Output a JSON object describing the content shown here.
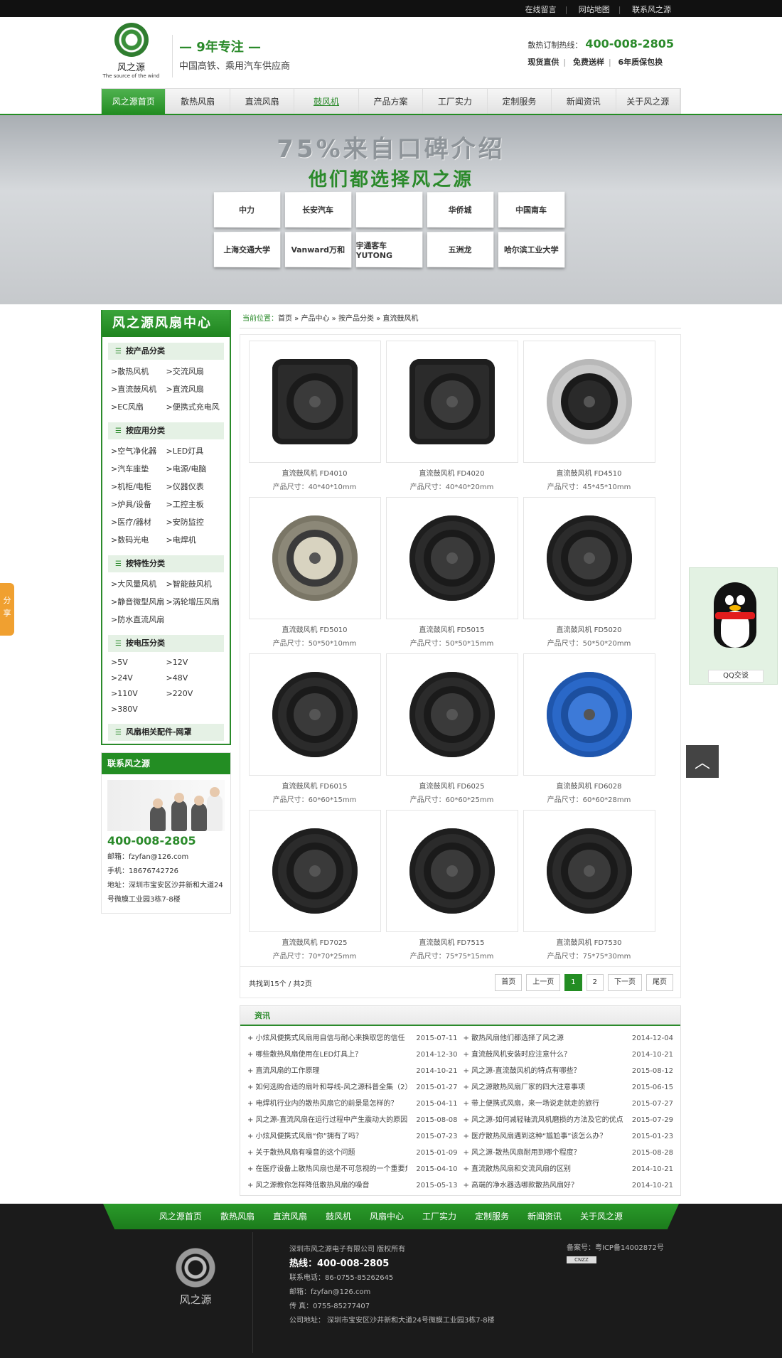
{
  "topbar": {
    "links": [
      "在线留言",
      "网站地图",
      "联系风之源"
    ]
  },
  "header": {
    "logo_cn": "风之源",
    "logo_en": "The source of the wind",
    "slogan_main": "— 9年专注 —",
    "slogan_sub": "中国高铁、乘用汽车供应商",
    "hotline_label": "散热订制热线：",
    "hotline": "400-008-2805",
    "features": [
      "现货直供",
      "免费送样",
      "6年质保包换"
    ]
  },
  "nav": [
    "风之源首页",
    "散热风扇",
    "直流风扇",
    "鼓风机",
    "产品方案",
    "工厂实力",
    "定制服务",
    "新闻资讯",
    "关于风之源"
  ],
  "banner": {
    "title": "75%来自口碑介绍",
    "subtitle": "他们都选择风之源",
    "logos": [
      "中力",
      "长安汽车",
      "",
      "华侨城",
      "中国南车",
      "上海交通大学",
      "Vanward万和",
      "宇通客车 YUTONG",
      "五洲龙",
      "哈尔滨工业大学"
    ]
  },
  "sidebar": {
    "title": "风之源风扇中心",
    "categories": [
      {
        "title": "按产品分类",
        "items": [
          ">散热风机",
          ">交流风扇",
          ">直流鼓风机",
          ">直流风扇",
          ">EC风扇",
          ">便携式充电风"
        ]
      },
      {
        "title": "按应用分类",
        "items": [
          ">空气净化器",
          ">LED灯具",
          ">汽车座垫",
          ">电源/电脑",
          ">机柜/电柜",
          ">仪器仪表",
          ">炉具/设备",
          ">工控主板",
          ">医疗/器材",
          ">安防监控",
          ">数码光电",
          ">电焊机"
        ]
      },
      {
        "title": "按特性分类",
        "items": [
          ">大风量风机",
          ">智能鼓风机",
          ">静音微型风扇",
          ">涡轮增压风扇",
          ">防水直流风扇"
        ]
      },
      {
        "title": "按电压分类",
        "items": [
          ">5V",
          ">12V",
          ">24V",
          ">48V",
          ">110V",
          ">220V",
          ">380V"
        ]
      },
      {
        "title": "风扇相关配件-网罩",
        "items": []
      }
    ],
    "contact": {
      "title": "联系风之源",
      "phone": "400-008-2805",
      "email": "邮箱：fzyfan@126.com",
      "mobile": "手机：18676742726",
      "address": "地址：深圳市宝安区沙井新和大道24号微膜工业园3栋7-8楼"
    }
  },
  "breadcrumb": {
    "label": "当前位置：",
    "path": "首页 » 产品中心 » 按产品分类 » 直流鼓风机"
  },
  "products": [
    {
      "name": "直流鼓风机 FD4010",
      "size": "产品尺寸：40*40*10mm",
      "style": "sq"
    },
    {
      "name": "直流鼓风机 FD4020",
      "size": "产品尺寸：40*40*20mm",
      "style": "sq"
    },
    {
      "name": "直流鼓风机 FD4510",
      "size": "产品尺寸：45*45*10mm",
      "style": "gray"
    },
    {
      "name": "直流鼓风机 FD5010",
      "size": "产品尺寸：50*50*10mm",
      "style": "bronze"
    },
    {
      "name": "直流鼓风机 FD5015",
      "size": "产品尺寸：50*50*15mm",
      "style": ""
    },
    {
      "name": "直流鼓风机 FD5020",
      "size": "产品尺寸：50*50*20mm",
      "style": ""
    },
    {
      "name": "直流鼓风机 FD6015",
      "size": "产品尺寸：60*60*15mm",
      "style": ""
    },
    {
      "name": "直流鼓风机 FD6025",
      "size": "产品尺寸：60*60*25mm",
      "style": ""
    },
    {
      "name": "直流鼓风机 FD6028",
      "size": "产品尺寸：60*60*28mm",
      "style": "blue"
    },
    {
      "name": "直流鼓风机 FD7025",
      "size": "产品尺寸：70*70*25mm",
      "style": ""
    },
    {
      "name": "直流鼓风机 FD7515",
      "size": "产品尺寸：75*75*15mm",
      "style": ""
    },
    {
      "name": "直流鼓风机 FD7530",
      "size": "产品尺寸：75*75*30mm",
      "style": ""
    }
  ],
  "pager": {
    "total": "共找到15个 / 共2页",
    "buttons": [
      "首页",
      "上一页",
      "1",
      "2",
      "下一页",
      "尾页"
    ],
    "current": "1"
  },
  "news": {
    "title": "资讯",
    "left": [
      {
        "t": "+ 小炫风便携式风扇用自信与耐心来换取您的信任",
        "d": "2015-07-11"
      },
      {
        "t": "+ 哪些散热风扇使用在LED灯具上？",
        "d": "2014-12-30"
      },
      {
        "t": "+ 直流风扇的工作原理",
        "d": "2014-10-21"
      },
      {
        "t": "+ 如何选购合适的扇叶和导线-风之源科普全集（2）",
        "d": "2015-01-27"
      },
      {
        "t": "+ 电焊机行业内的散热风扇它的前景是怎样的？",
        "d": "2015-04-11"
      },
      {
        "t": "+ 风之源-直流风扇在运行过程中产生震动大的原因是",
        "d": "2015-08-08"
      },
      {
        "t": "+ 小炫风便携式风扇“你”拥有了吗？",
        "d": "2015-07-23"
      },
      {
        "t": "+ 关于散热风扇有噪音的这个问题",
        "d": "2015-01-09"
      },
      {
        "t": "+ 在医疗设备上散热风扇也是不可忽视的一个重要角",
        "d": "2015-04-10"
      },
      {
        "t": "+ 风之源教你怎样降低散热风扇的噪音",
        "d": "2015-05-13"
      }
    ],
    "right": [
      {
        "t": "+ 散热风扇他们都选择了风之源",
        "d": "2014-12-04"
      },
      {
        "t": "+ 直流鼓风机安装时应注意什么？",
        "d": "2014-10-21"
      },
      {
        "t": "+ 风之源-直流鼓风机的特点有哪些？",
        "d": "2015-08-12"
      },
      {
        "t": "+ 风之源散热风扇厂家的四大注意事项",
        "d": "2015-06-15"
      },
      {
        "t": "+ 带上便携式风扇，来一场说走就走的旅行",
        "d": "2015-07-27"
      },
      {
        "t": "+ 风之源-如何减轻轴流风机磨损的方法及它的优点",
        "d": "2015-07-29"
      },
      {
        "t": "+ 医疗散热风扇遇到这种“尴尬事”该怎么办？",
        "d": "2015-01-23"
      },
      {
        "t": "+ 风之源-散热风扇耐用到哪个程度？",
        "d": "2015-08-28"
      },
      {
        "t": "+ 直流散热风扇和交流风扇的区别",
        "d": "2014-10-21"
      },
      {
        "t": "+ 高端的净水器选哪款散热风扇好？",
        "d": "2014-10-21"
      }
    ]
  },
  "footer": {
    "nav": [
      "风之源首页",
      "散热风扇",
      "直流风扇",
      "鼓风机",
      "风扇中心",
      "工厂实力",
      "定制服务",
      "新闻资讯",
      "关于风之源"
    ],
    "logo_cn": "风之源",
    "company": "深圳市风之源电子有限公司 版权所有",
    "hotline": "热线：400-008-2805",
    "tel": "联系电话：86-0755-85262645",
    "email": "邮箱：fzyfan@126.com",
    "fax": "传 真：0755-85277407",
    "address": "公司地址： 深圳市宝安区沙井新和大道24号微膜工业园3栋7-8楼",
    "icp": "备案号：粤ICP备14002872号",
    "cnzz": "CNZZ"
  },
  "floating": {
    "share": "分享",
    "qq": "QQ交谈",
    "totop": "︿"
  }
}
